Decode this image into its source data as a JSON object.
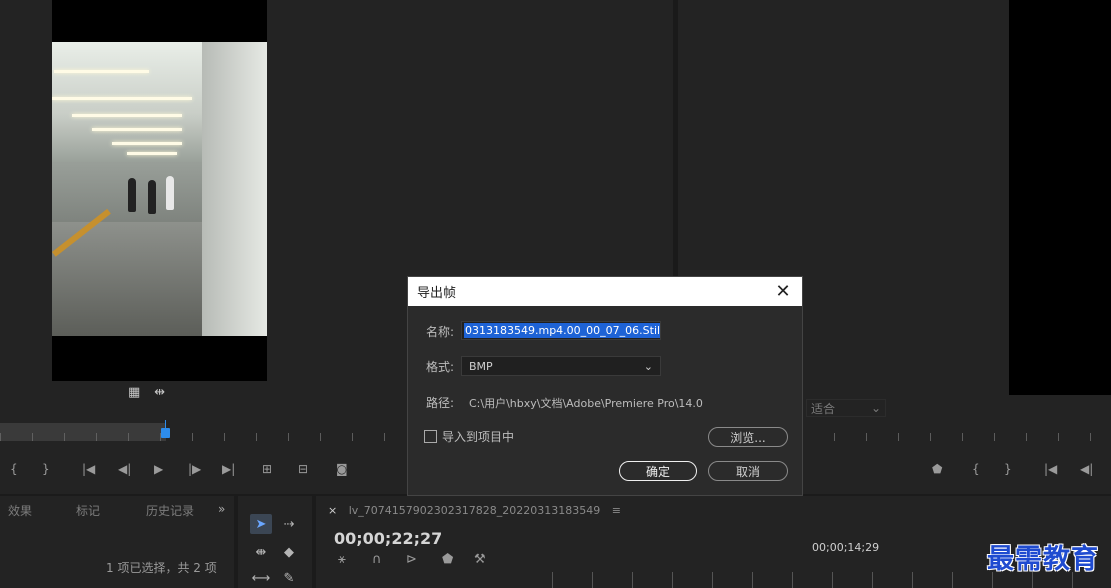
{
  "source_monitor": {
    "icons": [
      "film-icon",
      "wave-icon"
    ],
    "controls": [
      "{",
      "}",
      "|←",
      "◀|",
      "▶",
      "|▶",
      "→|",
      "⊞",
      "⊟",
      "📷"
    ]
  },
  "program_monitor": {
    "fit_label": "适合",
    "controls": [
      "⯃",
      "{",
      "}",
      "|←",
      "◀|"
    ]
  },
  "bottom": {
    "tabs": [
      "效果",
      "标记",
      "历史记录"
    ],
    "more": "»",
    "selection_status": "1 项已选择，共 2 项",
    "sequence_tab": "lv_7074157902302317828_20220313183549",
    "sequence_menu": "≡",
    "timecode": "00;00;22;27",
    "ruler_timecode": "00;00;14;29"
  },
  "dialog": {
    "title": "导出帧",
    "close": "✕",
    "name_label": "名称:",
    "name_value": "0313183549.mp4.00_00_07_06.Still001",
    "format_label": "格式:",
    "format_value": "BMP",
    "path_label": "路径:",
    "path_value": "C:\\用户\\hbxy\\文档\\Adobe\\Premiere Pro\\14.0",
    "import_label": "导入到项目中",
    "import_checked": false,
    "browse_label": "浏览...",
    "ok_label": "确定",
    "cancel_label": "取消"
  },
  "watermark": "最需教育",
  "colors": {
    "accent": "#2d8ceb",
    "selection": "#1e63d6",
    "watermark": "#1f4bd0"
  }
}
